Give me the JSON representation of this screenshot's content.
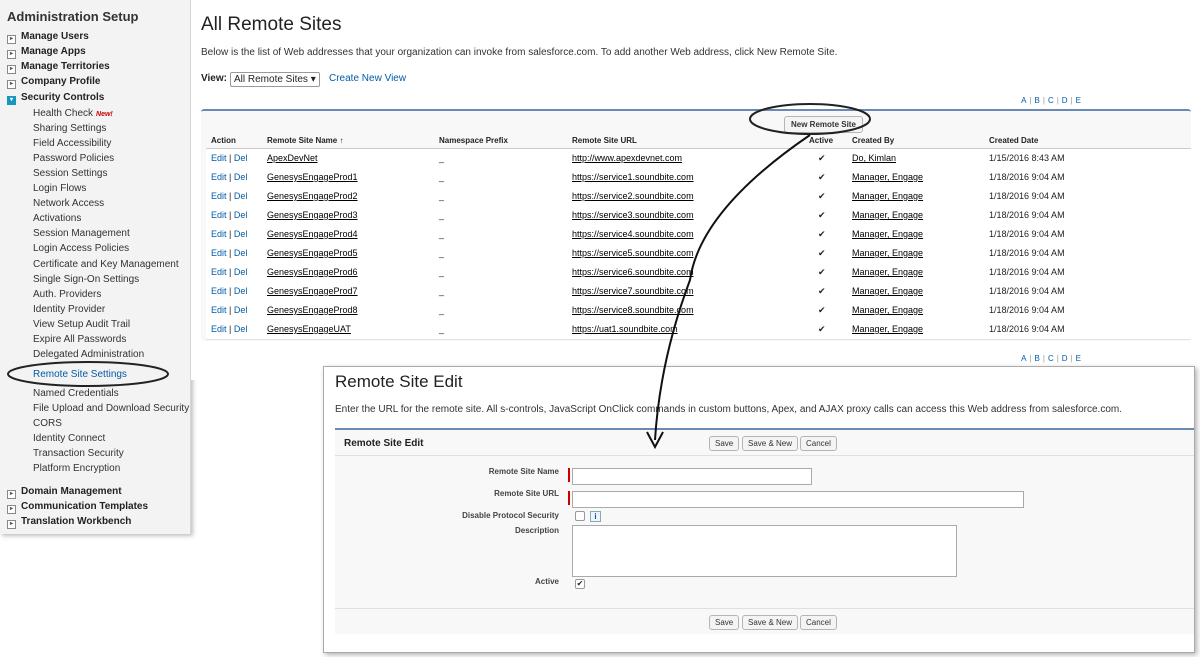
{
  "sidebar": {
    "title": "Administration Setup",
    "top_items": [
      {
        "label": "Manage Users"
      },
      {
        "label": "Manage Apps"
      },
      {
        "label": "Manage Territories"
      },
      {
        "label": "Company Profile"
      },
      {
        "label": "Security Controls"
      }
    ],
    "security_items": [
      "Health Check",
      "Sharing Settings",
      "Field Accessibility",
      "Password Policies",
      "Session Settings",
      "Login Flows",
      "Network Access",
      "Activations",
      "Session Management",
      "Login Access Policies",
      "Certificate and Key Management",
      "Single Sign-On Settings",
      "Auth. Providers",
      "Identity Provider",
      "View Setup Audit Trail",
      "Expire All Passwords",
      "Delegated Administration",
      "Remote Site Settings",
      "Named Credentials",
      "File Upload and Download Security",
      "CORS",
      "Identity Connect",
      "Transaction Security",
      "Platform Encryption"
    ],
    "new_badge": "New!",
    "bottom_items": [
      {
        "label": "Domain Management"
      },
      {
        "label": "Communication Templates"
      },
      {
        "label": "Translation Workbench"
      }
    ]
  },
  "main": {
    "title": "All Remote Sites",
    "description": "Below is the list of Web addresses that your organization can invoke from salesforce.com. To add another Web address, click New Remote Site.",
    "view_label": "View:",
    "view_selected": "All Remote Sites ▾",
    "create_view": "Create New View",
    "alpha": [
      "A",
      "B",
      "C",
      "D",
      "E"
    ],
    "new_button": "New Remote Site",
    "columns": [
      "Action",
      "Remote Site Name ↑",
      "Namespace Prefix",
      "Remote Site URL",
      "Active",
      "Created By",
      "Created Date"
    ],
    "action_edit": "Edit",
    "action_del": "Del",
    "rows": [
      {
        "name": "ApexDevNet",
        "prefix": "_",
        "url": "http://www.apexdevnet.com",
        "active": "✔",
        "by": "Do, Kimlan",
        "date": "1/15/2016 8:43 AM"
      },
      {
        "name": "GenesysEngageProd1",
        "prefix": "_",
        "url": "https://service1.soundbite.com",
        "active": "✔",
        "by": "Manager, Engage",
        "date": "1/18/2016 9:04 AM"
      },
      {
        "name": "GenesysEngageProd2",
        "prefix": "_",
        "url": "https://service2.soundbite.com",
        "active": "✔",
        "by": "Manager, Engage",
        "date": "1/18/2016 9:04 AM"
      },
      {
        "name": "GenesysEngageProd3",
        "prefix": "_",
        "url": "https://service3.soundbite.com",
        "active": "✔",
        "by": "Manager, Engage",
        "date": "1/18/2016 9:04 AM"
      },
      {
        "name": "GenesysEngageProd4",
        "prefix": "_",
        "url": "https://service4.soundbite.com",
        "active": "✔",
        "by": "Manager, Engage",
        "date": "1/18/2016 9:04 AM"
      },
      {
        "name": "GenesysEngageProd5",
        "prefix": "_",
        "url": "https://service5.soundbite.com",
        "active": "✔",
        "by": "Manager, Engage",
        "date": "1/18/2016 9:04 AM"
      },
      {
        "name": "GenesysEngageProd6",
        "prefix": "_",
        "url": "https://service6.soundbite.com",
        "active": "✔",
        "by": "Manager, Engage",
        "date": "1/18/2016 9:04 AM"
      },
      {
        "name": "GenesysEngageProd7",
        "prefix": "_",
        "url": "https://service7.soundbite.com",
        "active": "✔",
        "by": "Manager, Engage",
        "date": "1/18/2016 9:04 AM"
      },
      {
        "name": "GenesysEngageProd8",
        "prefix": "_",
        "url": "https://service8.soundbite.com",
        "active": "✔",
        "by": "Manager, Engage",
        "date": "1/18/2016 9:04 AM"
      },
      {
        "name": "GenesysEngageUAT",
        "prefix": "_",
        "url": "https://uat1.soundbite.com",
        "active": "✔",
        "by": "Manager, Engage",
        "date": "1/18/2016 9:04 AM"
      }
    ]
  },
  "edit": {
    "title": "Remote Site Edit",
    "description": "Enter the URL for the remote site. All s-controls, JavaScript OnClick commands in custom buttons, Apex, and AJAX proxy calls can access this Web address from salesforce.com.",
    "panel_title": "Remote Site Edit",
    "save": "Save",
    "save_new": "Save & New",
    "cancel": "Cancel",
    "fields": {
      "name_label": "Remote Site Name",
      "name_value": "",
      "url_label": "Remote Site URL",
      "url_value": "",
      "disable_label": "Disable Protocol Security",
      "disable_checked": false,
      "info_icon": "i",
      "desc_label": "Description",
      "desc_value": "",
      "active_label": "Active",
      "active_checked": true,
      "check_mark": "✔"
    }
  }
}
